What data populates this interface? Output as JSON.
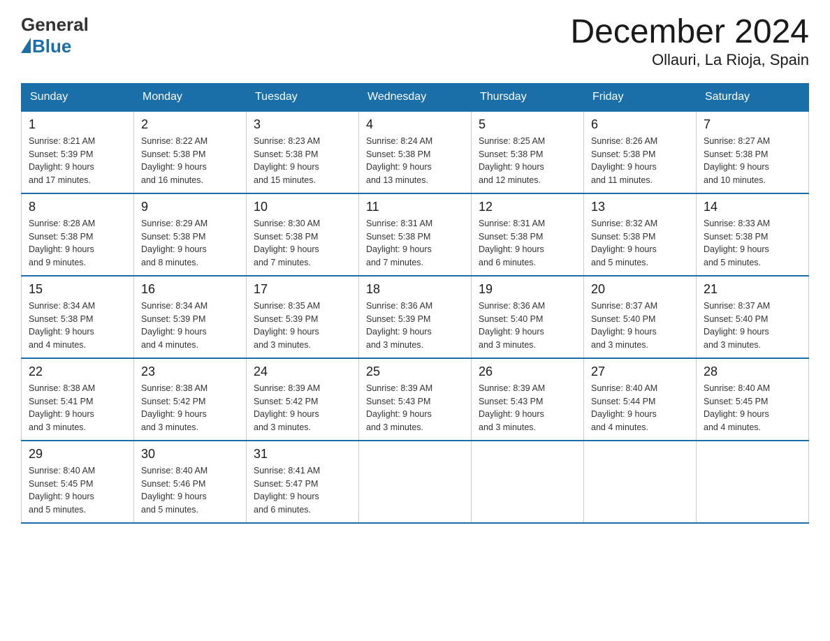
{
  "logo": {
    "general": "General",
    "blue": "Blue"
  },
  "title": "December 2024",
  "location": "Ollauri, La Rioja, Spain",
  "weekdays": [
    "Sunday",
    "Monday",
    "Tuesday",
    "Wednesday",
    "Thursday",
    "Friday",
    "Saturday"
  ],
  "weeks": [
    [
      {
        "day": "1",
        "sunrise": "8:21 AM",
        "sunset": "5:39 PM",
        "daylight": "9 hours and 17 minutes."
      },
      {
        "day": "2",
        "sunrise": "8:22 AM",
        "sunset": "5:38 PM",
        "daylight": "9 hours and 16 minutes."
      },
      {
        "day": "3",
        "sunrise": "8:23 AM",
        "sunset": "5:38 PM",
        "daylight": "9 hours and 15 minutes."
      },
      {
        "day": "4",
        "sunrise": "8:24 AM",
        "sunset": "5:38 PM",
        "daylight": "9 hours and 13 minutes."
      },
      {
        "day": "5",
        "sunrise": "8:25 AM",
        "sunset": "5:38 PM",
        "daylight": "9 hours and 12 minutes."
      },
      {
        "day": "6",
        "sunrise": "8:26 AM",
        "sunset": "5:38 PM",
        "daylight": "9 hours and 11 minutes."
      },
      {
        "day": "7",
        "sunrise": "8:27 AM",
        "sunset": "5:38 PM",
        "daylight": "9 hours and 10 minutes."
      }
    ],
    [
      {
        "day": "8",
        "sunrise": "8:28 AM",
        "sunset": "5:38 PM",
        "daylight": "9 hours and 9 minutes."
      },
      {
        "day": "9",
        "sunrise": "8:29 AM",
        "sunset": "5:38 PM",
        "daylight": "9 hours and 8 minutes."
      },
      {
        "day": "10",
        "sunrise": "8:30 AM",
        "sunset": "5:38 PM",
        "daylight": "9 hours and 7 minutes."
      },
      {
        "day": "11",
        "sunrise": "8:31 AM",
        "sunset": "5:38 PM",
        "daylight": "9 hours and 7 minutes."
      },
      {
        "day": "12",
        "sunrise": "8:31 AM",
        "sunset": "5:38 PM",
        "daylight": "9 hours and 6 minutes."
      },
      {
        "day": "13",
        "sunrise": "8:32 AM",
        "sunset": "5:38 PM",
        "daylight": "9 hours and 5 minutes."
      },
      {
        "day": "14",
        "sunrise": "8:33 AM",
        "sunset": "5:38 PM",
        "daylight": "9 hours and 5 minutes."
      }
    ],
    [
      {
        "day": "15",
        "sunrise": "8:34 AM",
        "sunset": "5:38 PM",
        "daylight": "9 hours and 4 minutes."
      },
      {
        "day": "16",
        "sunrise": "8:34 AM",
        "sunset": "5:39 PM",
        "daylight": "9 hours and 4 minutes."
      },
      {
        "day": "17",
        "sunrise": "8:35 AM",
        "sunset": "5:39 PM",
        "daylight": "9 hours and 3 minutes."
      },
      {
        "day": "18",
        "sunrise": "8:36 AM",
        "sunset": "5:39 PM",
        "daylight": "9 hours and 3 minutes."
      },
      {
        "day": "19",
        "sunrise": "8:36 AM",
        "sunset": "5:40 PM",
        "daylight": "9 hours and 3 minutes."
      },
      {
        "day": "20",
        "sunrise": "8:37 AM",
        "sunset": "5:40 PM",
        "daylight": "9 hours and 3 minutes."
      },
      {
        "day": "21",
        "sunrise": "8:37 AM",
        "sunset": "5:40 PM",
        "daylight": "9 hours and 3 minutes."
      }
    ],
    [
      {
        "day": "22",
        "sunrise": "8:38 AM",
        "sunset": "5:41 PM",
        "daylight": "9 hours and 3 minutes."
      },
      {
        "day": "23",
        "sunrise": "8:38 AM",
        "sunset": "5:42 PM",
        "daylight": "9 hours and 3 minutes."
      },
      {
        "day": "24",
        "sunrise": "8:39 AM",
        "sunset": "5:42 PM",
        "daylight": "9 hours and 3 minutes."
      },
      {
        "day": "25",
        "sunrise": "8:39 AM",
        "sunset": "5:43 PM",
        "daylight": "9 hours and 3 minutes."
      },
      {
        "day": "26",
        "sunrise": "8:39 AM",
        "sunset": "5:43 PM",
        "daylight": "9 hours and 3 minutes."
      },
      {
        "day": "27",
        "sunrise": "8:40 AM",
        "sunset": "5:44 PM",
        "daylight": "9 hours and 4 minutes."
      },
      {
        "day": "28",
        "sunrise": "8:40 AM",
        "sunset": "5:45 PM",
        "daylight": "9 hours and 4 minutes."
      }
    ],
    [
      {
        "day": "29",
        "sunrise": "8:40 AM",
        "sunset": "5:45 PM",
        "daylight": "9 hours and 5 minutes."
      },
      {
        "day": "30",
        "sunrise": "8:40 AM",
        "sunset": "5:46 PM",
        "daylight": "9 hours and 5 minutes."
      },
      {
        "day": "31",
        "sunrise": "8:41 AM",
        "sunset": "5:47 PM",
        "daylight": "9 hours and 6 minutes."
      },
      null,
      null,
      null,
      null
    ]
  ]
}
